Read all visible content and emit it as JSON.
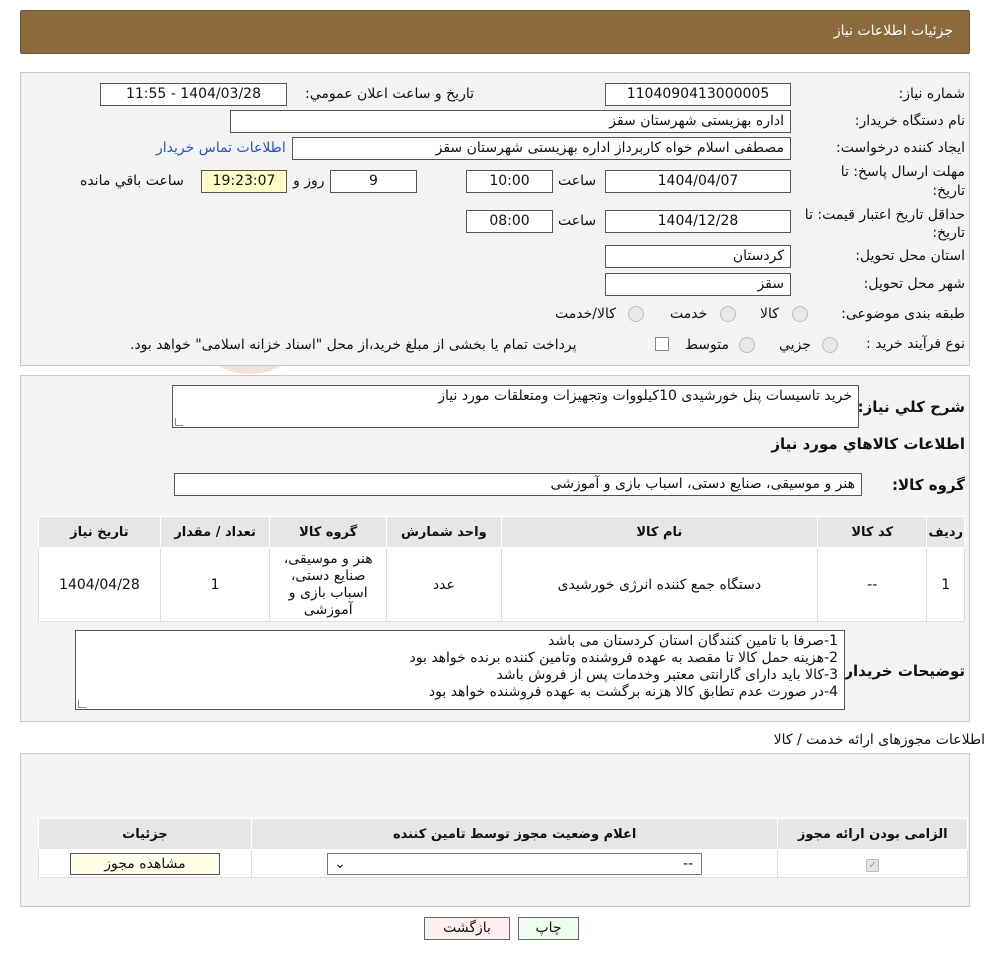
{
  "header": {
    "title": "جزئیات اطلاعات نیاز"
  },
  "form": {
    "need_number": {
      "label": "شماره نیاز:",
      "value": "1104090413000005"
    },
    "announce_datetime": {
      "label": "تاریخ و ساعت اعلان عمومي:",
      "value": "1404/03/28 - 11:55"
    },
    "buyer_org": {
      "label": "نام دستگاه خریدار:",
      "value": "اداره بهزیستی شهرستان سقز"
    },
    "requester": {
      "label": "ایجاد کننده درخواست:",
      "value": "مصطفی  اسلام خواه  کاربرداز اداره بهزیستی شهرستان سقز"
    },
    "contact_link": "اطلاعات تماس خریدار",
    "deadline": {
      "label_line1": "مهلت ارسال پاسخ: تا",
      "label_line2": "تاریخ:",
      "date": "1404/04/07",
      "time_label": "ساعت",
      "time": "10:00",
      "days": "9",
      "days_label": "روز و",
      "remaining": "19:23:07",
      "remaining_label": "ساعت باقي مانده"
    },
    "validity": {
      "label_line1": "حداقل تاریخ اعتبار قیمت: تا",
      "label_line2": "تاریخ:",
      "date": "1404/12/28",
      "time_label": "ساعت",
      "time": "08:00"
    },
    "province": {
      "label": "استان محل تحویل:",
      "value": "کردستان"
    },
    "city": {
      "label": "شهر محل تحویل:",
      "value": "سقز"
    },
    "category": {
      "label": "طبقه بندی موضوعی:",
      "options": [
        "کالا",
        "خدمت",
        "کالا/خدمت"
      ]
    },
    "purchase_type": {
      "label": "نوع فرآیند خرید :",
      "options": [
        "جزیي",
        "متوسط"
      ],
      "note": "پرداخت تمام یا بخشی از مبلغ خرید،از محل \"اسناد خزانه اسلامی\" خواهد بود."
    }
  },
  "description": {
    "label": "شرح کلي نیاز:",
    "value": "خرید تاسیسات پنل خورشیدی 10کیلووات وتجهیزات ومتعلقات مورد نیاز"
  },
  "goods_section": {
    "title": "اطلاعات کالاهاي مورد نیاز",
    "group_label": "گروه کالا:",
    "group_value": "هنر و موسیقی، صنایع دستی، اسباب بازی و آموزشی"
  },
  "goods_table": {
    "headers": [
      "ردیف",
      "کد کالا",
      "نام کالا",
      "واحد شمارش",
      "گروه کالا",
      "تعداد / مقدار",
      "تاریخ نیاز"
    ],
    "row": {
      "index": "1",
      "code": "--",
      "name": "دستگاه جمع کننده انرژی خورشیدی",
      "unit": "عدد",
      "group": "هنر و موسیقی، صنایع دستی، اسباب بازی و آموزشی",
      "qty": "1",
      "date": "1404/04/28"
    }
  },
  "buyer_notes": {
    "label": "توضیحات خریدار:",
    "lines": [
      "1-صرفا با تامین کنندگان استان کردستان می باشد",
      "2-هزینه حمل کالا تا مقصد به عهده فروشنده وتامین کننده برنده خواهد بود",
      "3-کالا باید دارای گارانتی معتبر وخدمات پس از فروش باشد",
      "4-در صورت عدم تطابق کالا هزنه برگشت به عهده فروشنده خواهد بود"
    ]
  },
  "permits": {
    "title": "اطلاعات مجوزهای ارائه خدمت / کالا",
    "headers": [
      "الزامی بودن ارائه مجوز",
      "اعلام وضعیت مجوز توسط تامین کننده",
      "جزئیات"
    ],
    "select_value": "--",
    "view_button": "مشاهده مجوز"
  },
  "buttons": {
    "print": "چاپ",
    "back": "بازگشت"
  },
  "watermark": "AriaTender.neT"
}
